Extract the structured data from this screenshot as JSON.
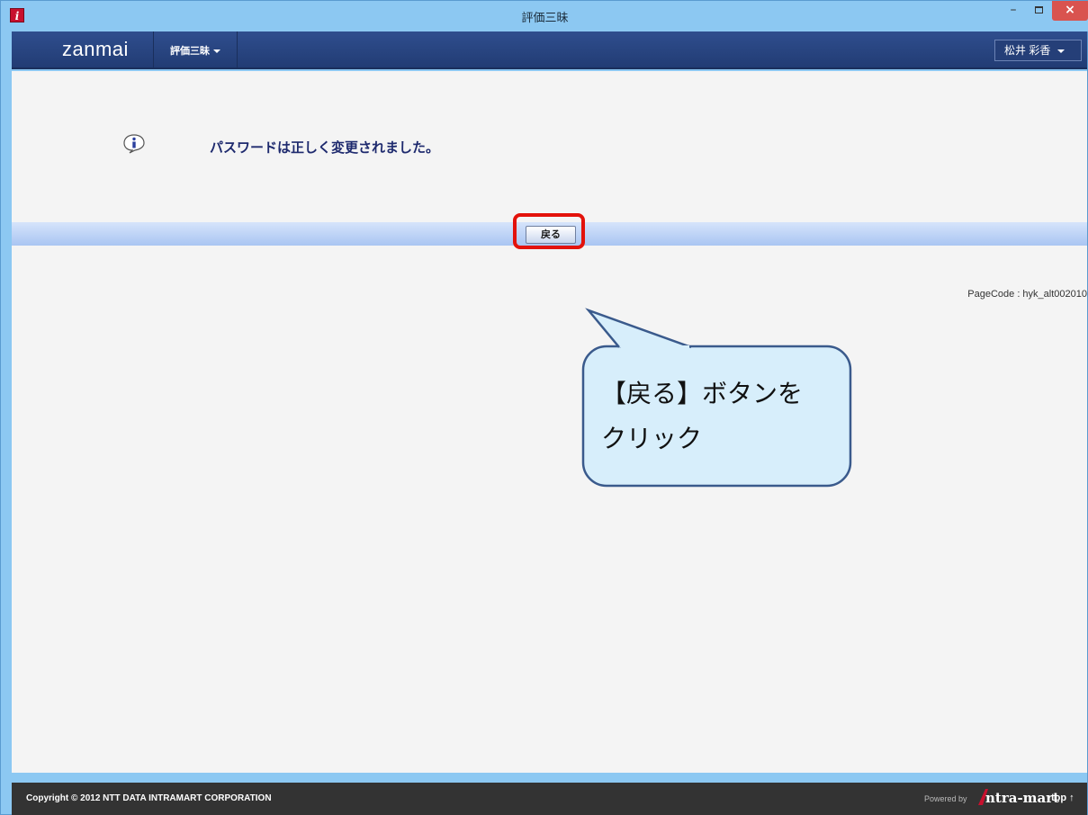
{
  "window": {
    "title": "評価三昧",
    "icon_letter": "i"
  },
  "navbar": {
    "brand": "zanmai",
    "menu_label": "評価三昧",
    "user_name": "松井 彩香"
  },
  "content": {
    "message": "パスワードは正しく変更されました。",
    "back_button": "戻る",
    "page_code": "PageCode : hyk_alt002010"
  },
  "callout": {
    "line1": "【戻る】ボタンを",
    "line2": "クリック"
  },
  "footer": {
    "copyright": "Copyright © 2012 NTT DATA INTRAMART CORPORATION",
    "powered_by": "Powered by",
    "logo_text": "ntra-mart",
    "top_link": "top ↑"
  },
  "colors": {
    "navbar": "#2f4e8e",
    "highlight": "#e3120b",
    "callout_fill": "#d7eefb",
    "callout_border": "#3a5a8c",
    "footer": "#333333"
  }
}
